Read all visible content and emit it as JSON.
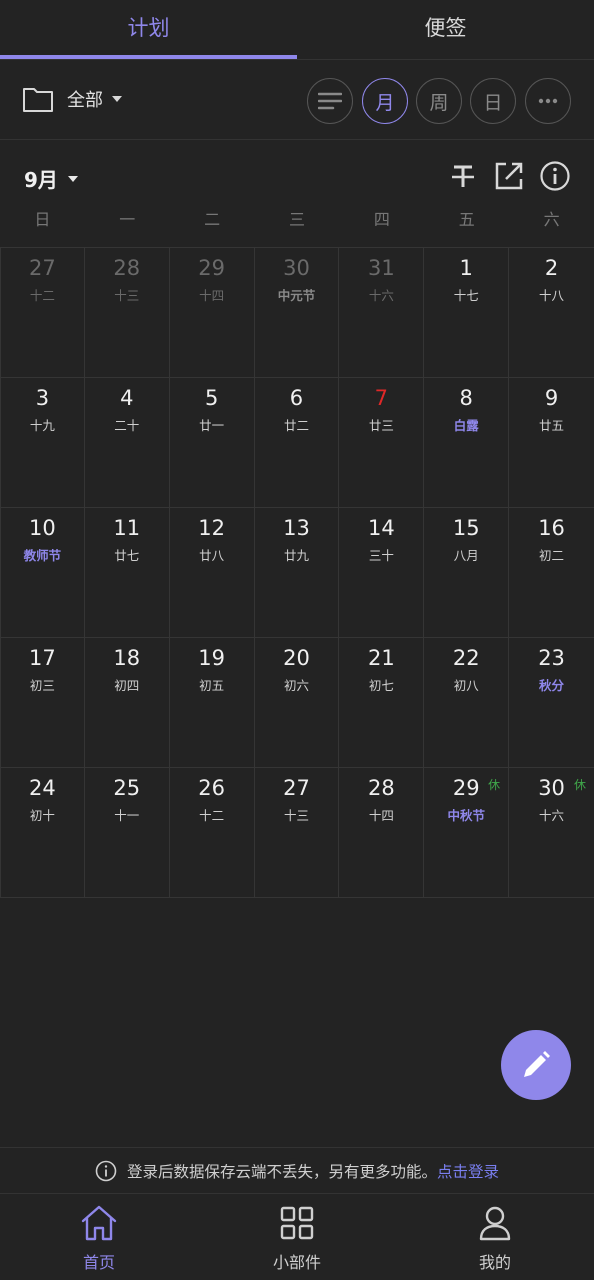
{
  "tabs": [
    {
      "label": "计划",
      "active": true
    },
    {
      "label": "便签",
      "active": false
    }
  ],
  "toolbar": {
    "folder_label": "全部",
    "views": [
      {
        "icon": "list-icon",
        "label": ""
      },
      {
        "icon": "month",
        "label": "月"
      },
      {
        "icon": "week",
        "label": "周"
      },
      {
        "icon": "day",
        "label": "日"
      },
      {
        "icon": "more-icon",
        "label": "···"
      }
    ]
  },
  "month": {
    "title": "9月"
  },
  "weekdays": [
    "日",
    "一",
    "二",
    "三",
    "四",
    "五",
    "六"
  ],
  "calendar": {
    "cells": [
      {
        "day": "27",
        "lunar": "十二",
        "dim": true
      },
      {
        "day": "28",
        "lunar": "十三",
        "dim": true
      },
      {
        "day": "29",
        "lunar": "十四",
        "dim": true
      },
      {
        "day": "30",
        "lunar": "中元节",
        "dim": true,
        "festival": true
      },
      {
        "day": "31",
        "lunar": "十六",
        "dim": true
      },
      {
        "day": "1",
        "lunar": "十七"
      },
      {
        "day": "2",
        "lunar": "十八"
      },
      {
        "day": "3",
        "lunar": "十九"
      },
      {
        "day": "4",
        "lunar": "二十"
      },
      {
        "day": "5",
        "lunar": "廿一"
      },
      {
        "day": "6",
        "lunar": "廿二"
      },
      {
        "day": "7",
        "lunar": "廿三",
        "today": true
      },
      {
        "day": "8",
        "lunar": "白露",
        "term": true
      },
      {
        "day": "9",
        "lunar": "廿五"
      },
      {
        "day": "10",
        "lunar": "教师节",
        "term": true
      },
      {
        "day": "11",
        "lunar": "廿七"
      },
      {
        "day": "12",
        "lunar": "廿八"
      },
      {
        "day": "13",
        "lunar": "廿九"
      },
      {
        "day": "14",
        "lunar": "三十"
      },
      {
        "day": "15",
        "lunar": "八月"
      },
      {
        "day": "16",
        "lunar": "初二"
      },
      {
        "day": "17",
        "lunar": "初三"
      },
      {
        "day": "18",
        "lunar": "初四"
      },
      {
        "day": "19",
        "lunar": "初五"
      },
      {
        "day": "20",
        "lunar": "初六"
      },
      {
        "day": "21",
        "lunar": "初七"
      },
      {
        "day": "22",
        "lunar": "初八"
      },
      {
        "day": "23",
        "lunar": "秋分",
        "term": true
      },
      {
        "day": "24",
        "lunar": "初十"
      },
      {
        "day": "25",
        "lunar": "十一"
      },
      {
        "day": "26",
        "lunar": "十二"
      },
      {
        "day": "27",
        "lunar": "十三"
      },
      {
        "day": "28",
        "lunar": "十四"
      },
      {
        "day": "29",
        "lunar": "中秋节",
        "term": true,
        "badge": "休"
      },
      {
        "day": "30",
        "lunar": "十六",
        "badge": "休"
      }
    ]
  },
  "banner": {
    "text": "登录后数据保存云端不丢失，另有更多功能。",
    "link": "点击登录"
  },
  "nav": [
    {
      "label": "首页",
      "icon": "home-icon",
      "active": true
    },
    {
      "label": "小部件",
      "icon": "widgets-icon",
      "active": false
    },
    {
      "label": "我的",
      "icon": "profile-icon",
      "active": false
    }
  ],
  "colors": {
    "accent": "#8f87ea",
    "background": "#232323",
    "today_red": "#e02828",
    "holiday_green": "#3fa64a",
    "link_blue": "#7a7ff0"
  }
}
